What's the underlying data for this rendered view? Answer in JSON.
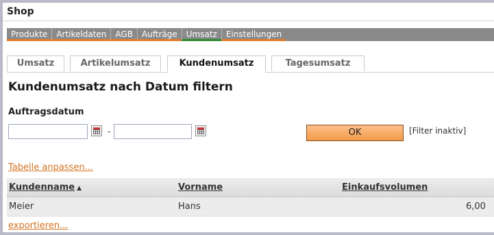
{
  "app": {
    "title": "Shop"
  },
  "nav": {
    "items": [
      {
        "label": "Produkte"
      },
      {
        "label": "Artikeldaten"
      },
      {
        "label": "AGB"
      },
      {
        "label": "Aufträge"
      },
      {
        "label": "Umsatz",
        "active": true
      },
      {
        "label": "Einstellungen"
      }
    ]
  },
  "subtabs": {
    "items": [
      {
        "label": "Umsatz"
      },
      {
        "label": "Artikelumsatz"
      },
      {
        "label": "Kundenumsatz",
        "active": true
      },
      {
        "label": "Tagesumsatz"
      }
    ]
  },
  "page": {
    "title": "Kundenumsatz nach Datum filtern"
  },
  "filter": {
    "label": "Auftragsdatum",
    "from_value": "",
    "to_value": "",
    "separator": "-",
    "ok_label": "OK",
    "status": "[Filter inaktiv]",
    "calendar_icon": "calendar-icon"
  },
  "links": {
    "customize": "Tabelle anpassen...",
    "export": "exportieren..."
  },
  "table": {
    "columns": [
      {
        "label": "Kundenname",
        "sorted": "asc"
      },
      {
        "label": "Vorname"
      },
      {
        "label": "Einkaufsvolumen"
      }
    ],
    "rows": [
      {
        "kundenname": "Meier",
        "vorname": "Hans",
        "einkaufsvolumen": "6,00"
      }
    ]
  },
  "colors": {
    "accent": "#e27b2a",
    "nav_bg": "#8a8a8a",
    "active_tab_underline": "#2a8a2a",
    "link": "#d2721f"
  }
}
